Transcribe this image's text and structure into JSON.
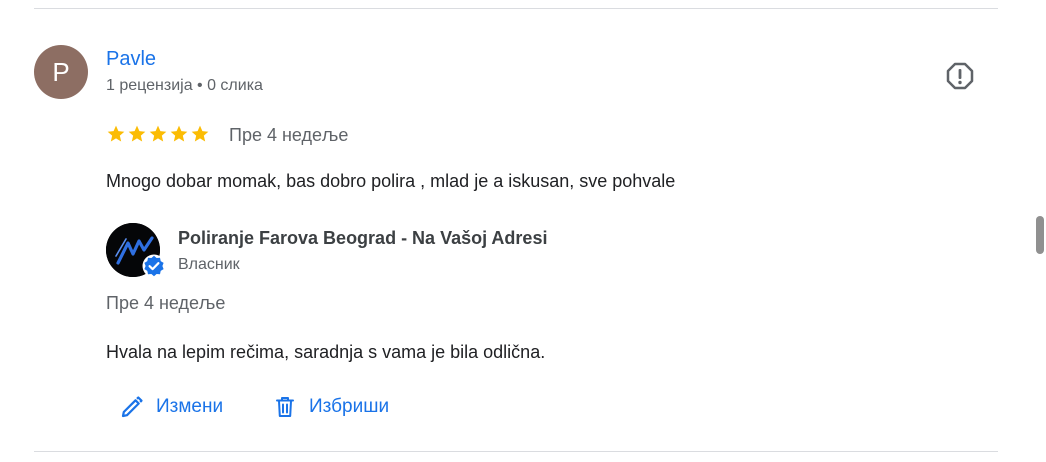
{
  "review": {
    "reviewer_initial": "P",
    "reviewer_name": "Pavle",
    "reviewer_meta": "1 рецензија • 0 слика",
    "rating": 5,
    "date": "Пре 4 недеље",
    "text": "Mnogo dobar momak, bas dobro polira , mlad je a iskusan, sve pohvale",
    "colors": {
      "avatar": "#8d6e63",
      "name": "#1a73e8",
      "star": "#fbbc04"
    }
  },
  "reply": {
    "owner_name": "Poliranje Farova Beograd - Na Vašoj Adresi",
    "owner_role": "Власник",
    "date": "Пре 4 недеље",
    "text": "Hvala na lepim rečima, saradnja s vama je bila odlična.",
    "actions": {
      "edit_label": "Измени",
      "delete_label": "Избриши"
    },
    "colors": {
      "action": "#1a73e8",
      "verified": "#1a73e8"
    }
  },
  "icons": {
    "report": "report-icon",
    "edit": "pencil-icon",
    "delete": "trash-icon",
    "verified": "verified-badge-icon",
    "star": "star-icon"
  }
}
